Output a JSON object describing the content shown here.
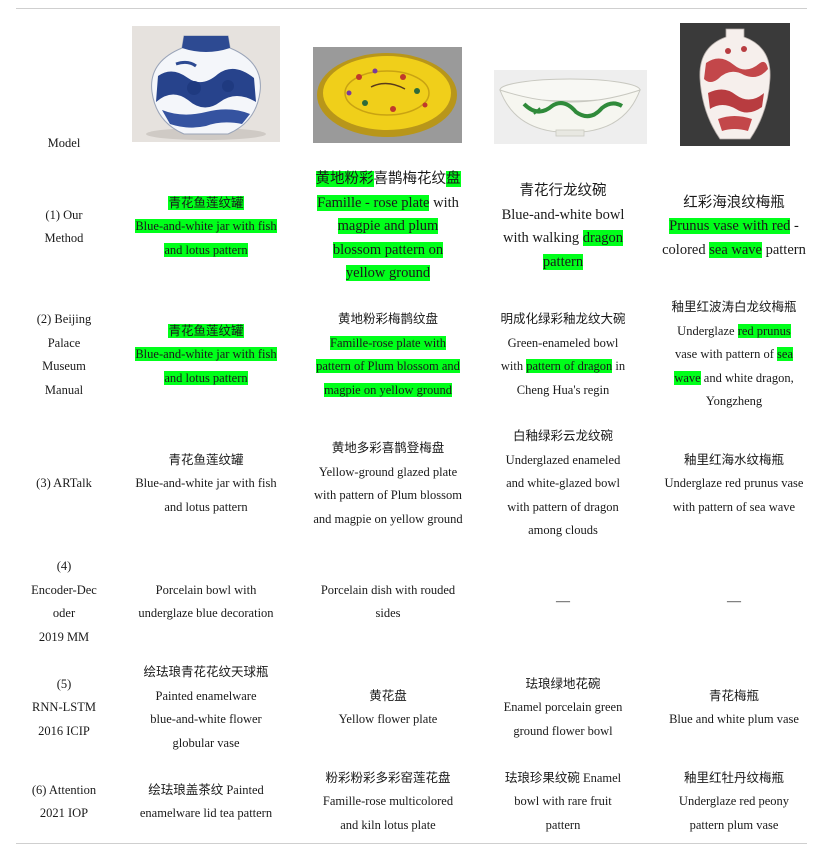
{
  "header": {
    "model_label": "Model"
  },
  "images": [
    {
      "icon": "blue-white-jar-image",
      "subject": "porcelain"
    },
    {
      "icon": "yellow-plate-image",
      "subject": "porcelain"
    },
    {
      "icon": "green-bowl-image",
      "subject": "porcelain"
    },
    {
      "icon": "red-vase-image",
      "subject": "porcelain"
    }
  ],
  "colors": {
    "highlight": "#00ff1a",
    "rule": "#cfcfcf"
  },
  "rows": [
    {
      "label_lines": [
        "(1) Our",
        "Method"
      ],
      "cells": [
        {
          "lines": [
            [
              {
                "t": "青花鱼莲纹罐",
                "h": true
              }
            ],
            [
              {
                "t": "Blue-and-white jar with fish",
                "h": true
              }
            ],
            [
              {
                "t": "and lotus pattern",
                "h": true
              }
            ]
          ]
        },
        {
          "lines": [
            [
              {
                "t": "黄地粉彩",
                "h": true
              },
              {
                "t": "喜鹊梅花纹",
                "h": false
              },
              {
                "t": "盘",
                "h": true
              }
            ],
            [
              {
                "t": "Famille - rose plate",
                "h": true
              },
              {
                "t": " with",
                "h": false
              }
            ],
            [
              {
                "t": "magpie and plum",
                "h": true
              }
            ],
            [
              {
                "t": "blossom pattern on",
                "h": true
              }
            ],
            [
              {
                "t": "yellow ground",
                "h": true
              }
            ]
          ]
        },
        {
          "lines": [
            [
              {
                "t": "青花行龙纹碗",
                "h": false
              }
            ],
            [
              {
                "t": "Blue-and-white bowl",
                "h": false
              }
            ],
            [
              {
                "t": "with walking ",
                "h": false
              },
              {
                "t": "dragon",
                "h": true
              }
            ],
            [
              {
                "t": "pattern",
                "h": true
              }
            ]
          ]
        },
        {
          "lines": [
            [
              {
                "t": "红彩海浪纹梅瓶",
                "h": false
              }
            ],
            [
              {
                "t": "Prunus vase with red",
                "h": true
              },
              {
                "t": " -",
                "h": false
              }
            ],
            [
              {
                "t": "colored ",
                "h": false
              },
              {
                "t": "sea wave",
                "h": true
              },
              {
                "t": " pattern",
                "h": false
              }
            ]
          ]
        }
      ]
    },
    {
      "label_lines": [
        "(2) Beijing",
        "Palace",
        "Museum",
        "Manual"
      ],
      "cells": [
        {
          "lines": [
            [
              {
                "t": "青花鱼莲纹罐",
                "h": true
              }
            ],
            [
              {
                "t": "Blue-and-white jar with fish",
                "h": true
              }
            ],
            [
              {
                "t": "and lotus pattern",
                "h": true
              }
            ]
          ]
        },
        {
          "lines": [
            [
              {
                "t": "黄地粉彩梅鹊纹盘",
                "h": false
              }
            ],
            [
              {
                "t": "Famille-rose plate with",
                "h": true
              }
            ],
            [
              {
                "t": "pattern of Plum blossom and",
                "h": true
              }
            ],
            [
              {
                "t": "magpie on yellow ground",
                "h": true
              }
            ]
          ]
        },
        {
          "lines": [
            [
              {
                "t": "明成化绿彩釉龙纹大碗",
                "h": false
              }
            ],
            [
              {
                "t": "Green-enameled bowl",
                "h": false
              }
            ],
            [
              {
                "t": "with ",
                "h": false
              },
              {
                "t": "pattern of dragon",
                "h": true
              },
              {
                "t": " in",
                "h": false
              }
            ],
            [
              {
                "t": "Cheng Hua's regin",
                "h": false
              }
            ]
          ]
        },
        {
          "lines": [
            [
              {
                "t": "釉里红波涛白龙纹梅瓶",
                "h": false
              }
            ],
            [
              {
                "t": "Underglaze ",
                "h": false
              },
              {
                "t": "red prunus",
                "h": true
              }
            ],
            [
              {
                "t": "vase with pattern of ",
                "h": false
              },
              {
                "t": "sea",
                "h": true
              }
            ],
            [
              {
                "t": "wave",
                "h": true
              },
              {
                "t": " and white dragon,",
                "h": false
              }
            ],
            [
              {
                "t": "Yongzheng",
                "h": false
              }
            ]
          ]
        }
      ]
    },
    {
      "label_lines": [
        "(3) ARTalk"
      ],
      "cells": [
        {
          "lines": [
            [
              {
                "t": "青花鱼莲纹罐",
                "h": false
              }
            ],
            [
              {
                "t": "Blue-and-white jar with fish",
                "h": false
              }
            ],
            [
              {
                "t": "and lotus pattern",
                "h": false
              }
            ]
          ]
        },
        {
          "lines": [
            [
              {
                "t": "黄地多彩喜鹊登梅盘",
                "h": false
              }
            ],
            [
              {
                "t": "Yellow-ground glazed plate",
                "h": false
              }
            ],
            [
              {
                "t": "with pattern of Plum blossom",
                "h": false
              }
            ],
            [
              {
                "t": "and magpie on yellow ground",
                "h": false
              }
            ]
          ]
        },
        {
          "lines": [
            [
              {
                "t": "白釉绿彩云龙纹碗",
                "h": false
              }
            ],
            [
              {
                "t": "Underglazed enameled",
                "h": false
              }
            ],
            [
              {
                "t": "and white-glazed bowl",
                "h": false
              }
            ],
            [
              {
                "t": "with pattern of dragon",
                "h": false
              }
            ],
            [
              {
                "t": "among clouds",
                "h": false
              }
            ]
          ]
        },
        {
          "lines": [
            [
              {
                "t": "釉里红海水纹梅瓶",
                "h": false
              }
            ],
            [
              {
                "t": "Underglaze red prunus vase",
                "h": false
              }
            ],
            [
              {
                "t": "with pattern of sea wave",
                "h": false
              }
            ]
          ]
        }
      ]
    },
    {
      "label_lines": [
        "(4)",
        "Encoder-Dec",
        "oder",
        "2019 MM"
      ],
      "cells": [
        {
          "lines": [
            [
              {
                "t": "Porcelain bowl with",
                "h": false
              }
            ],
            [
              {
                "t": "underglaze blue decoration",
                "h": false
              }
            ]
          ]
        },
        {
          "lines": [
            [
              {
                "t": "Porcelain dish with rouded",
                "h": false
              }
            ],
            [
              {
                "t": "sides",
                "h": false
              }
            ]
          ]
        },
        {
          "lines": [
            [
              {
                "t": "—",
                "h": false
              }
            ]
          ]
        },
        {
          "lines": [
            [
              {
                "t": "—",
                "h": false
              }
            ]
          ]
        }
      ]
    },
    {
      "label_lines": [
        "(5)",
        "RNN-LSTM",
        "2016 ICIP"
      ],
      "cells": [
        {
          "lines": [
            [
              {
                "t": "绘珐琅青花花纹天球瓶",
                "h": false
              }
            ],
            [
              {
                "t": "Painted enamelware",
                "h": false
              }
            ],
            [
              {
                "t": "blue-and-white flower",
                "h": false
              }
            ],
            [
              {
                "t": "globular vase",
                "h": false
              }
            ]
          ]
        },
        {
          "lines": [
            [
              {
                "t": "黄花盘",
                "h": false
              }
            ],
            [
              {
                "t": "Yellow flower plate",
                "h": false
              }
            ]
          ]
        },
        {
          "lines": [
            [
              {
                "t": "珐琅绿地花碗",
                "h": false
              }
            ],
            [
              {
                "t": "Enamel porcelain green",
                "h": false
              }
            ],
            [
              {
                "t": "ground flower bowl",
                "h": false
              }
            ]
          ]
        },
        {
          "lines": [
            [
              {
                "t": "青花梅瓶",
                "h": false
              }
            ],
            [
              {
                "t": "Blue and white plum vase",
                "h": false
              }
            ]
          ]
        }
      ]
    },
    {
      "label_lines": [
        "(6) Attention",
        "2021 IOP"
      ],
      "cells": [
        {
          "lines": [
            [
              {
                "t": "绘珐琅盖茶纹  Painted",
                "h": false
              }
            ],
            [
              {
                "t": "enamelware lid tea pattern",
                "h": false
              }
            ]
          ]
        },
        {
          "lines": [
            [
              {
                "t": "粉彩粉彩多彩窑莲花盘",
                "h": false
              }
            ],
            [
              {
                "t": "Famille-rose multicolored",
                "h": false
              }
            ],
            [
              {
                "t": "and kiln lotus plate",
                "h": false
              }
            ]
          ]
        },
        {
          "lines": [
            [
              {
                "t": "珐琅珍果纹碗  Enamel",
                "h": false
              }
            ],
            [
              {
                "t": "bowl with rare fruit",
                "h": false
              }
            ],
            [
              {
                "t": "pattern",
                "h": false
              }
            ]
          ]
        },
        {
          "lines": [
            [
              {
                "t": "釉里红牡丹纹梅瓶",
                "h": false
              }
            ],
            [
              {
                "t": "Underglaze red peony",
                "h": false
              }
            ],
            [
              {
                "t": "pattern plum vase",
                "h": false
              }
            ]
          ]
        }
      ]
    }
  ]
}
